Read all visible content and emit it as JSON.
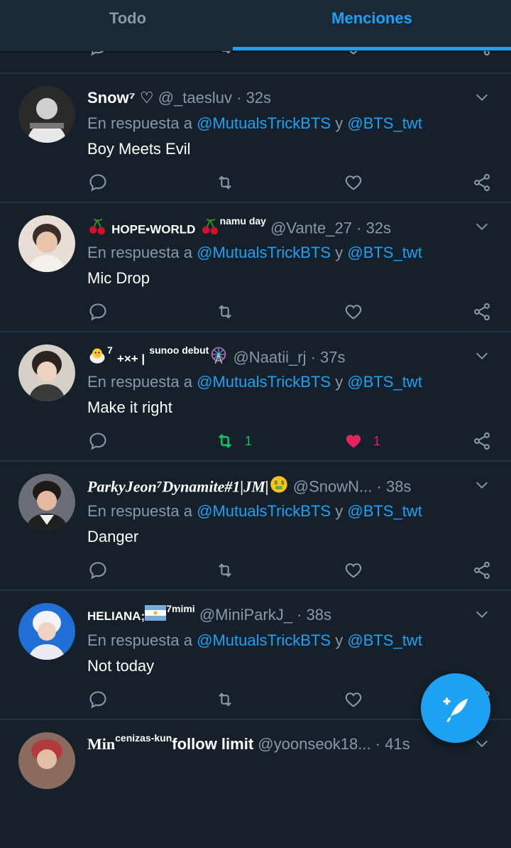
{
  "tabs": {
    "todo": "Todo",
    "menciones": "Menciones"
  },
  "reply_prefix": "En respuesta a",
  "reply_and": "y",
  "colors": {
    "accent": "#1da1f2",
    "background": "#15202b",
    "muted": "#8899a6",
    "like": "#e0245e",
    "retweet": "#17bf63"
  },
  "tweets": [
    {
      "name": "Snow⁷ ♡",
      "handle": "@_taesluv",
      "time": "32s",
      "mention1": "@MutualsTrickBTS",
      "mention2": "@BTS_twt",
      "text": "Boy Meets Evil"
    },
    {
      "name_pre_emoji": "cherries",
      "name": "HOPE•WORLD",
      "name_post_emoji": "cherries",
      "name_sup": "namu day",
      "handle": "@Vante_27",
      "time": "32s",
      "mention1": "@MutualsTrickBTS",
      "mention2": "@BTS_twt",
      "text": "Mic Drop"
    },
    {
      "name_pre_emoji": "chick",
      "name_sup_a": "7",
      "name": "+×+ |",
      "name_sup": "sunoo debut",
      "name_post_emoji": "ferris-wheel",
      "handle": "@Naatii_rj",
      "time": "37s",
      "mention1": "@MutualsTrickBTS",
      "mention2": "@BTS_twt",
      "text": "Make it right",
      "retweet_count": "1",
      "like_count": "1"
    },
    {
      "name": "ParkyJeon⁷Dynamite#1|JM|",
      "name_post_emoji": "money-mouth-face",
      "handle": "@SnowN...",
      "time": "38s",
      "mention1": "@MutualsTrickBTS",
      "mention2": "@BTS_twt",
      "text": "Danger"
    },
    {
      "name": "HELIANA;",
      "name_post_emoji": "argentina-flag",
      "name_sup": "7mimi",
      "handle": "@MiniParkJ_",
      "time": "38s",
      "mention1": "@MutualsTrickBTS",
      "mention2": "@BTS_twt",
      "text": "Not today"
    },
    {
      "name": "Min",
      "name_sup": "cenizas-kun",
      "name_tail": "follow limit",
      "handle": "@yoonseok18...",
      "time": "41s"
    }
  ]
}
